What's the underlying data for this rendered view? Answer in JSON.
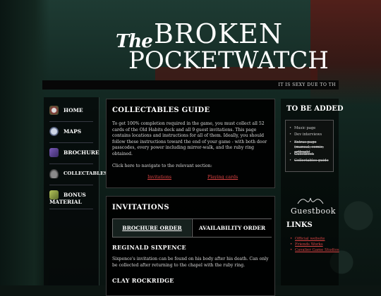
{
  "logo": {
    "the": "The",
    "broken": "BROKEN",
    "pocketwatch": "POCKETWATCH"
  },
  "ticker": "IT IS SEXY DUE TO TH",
  "nav": {
    "items": [
      {
        "label": "Home",
        "icon": "clock-icon"
      },
      {
        "label": "Maps",
        "icon": "mask-icon"
      },
      {
        "label": "Brochure",
        "icon": "crown-icon"
      },
      {
        "label": "Collectables",
        "icon": "hat-icon"
      },
      {
        "label": "Bonus",
        "label2": "Material",
        "icon": "bonus-icon"
      }
    ]
  },
  "guide": {
    "title": "Collectables Guide",
    "body": "To get 100% completion required in the game, you must collect all 52 cards of the Old Habits deck and all 9 guest invitations. This page contains locations and instructions for all of them. Ideally, you should follow these instructions toward the end of your game - with both door passcodes, every power including mirror-walk, and the ruby ring obtained.",
    "nav_prompt": "Click here to navigate to the relevant section:",
    "link_invitations": "Invitations",
    "link_cards": "Playing cards"
  },
  "invitations": {
    "title": "Invitations",
    "tab_brochure": "Brochure order",
    "tab_availability": "Availability order",
    "entry1_name": "Reginald Sixpence",
    "entry1_text": "Sixpence's invitation can be found on his body after his death. Can only be collected after returning to the chapel with the ruby ring.",
    "entry2_name": "Clay Rockridge"
  },
  "sidebar": {
    "to_be_added_title": "To be added",
    "todo": [
      {
        "text": "Music page",
        "struck": false
      },
      {
        "text": "Dev interviews",
        "struck": false
      },
      {
        "text": "Extras page (manual, comic, artbook)",
        "struck": true
      },
      {
        "text": "Guestbook",
        "struck": true
      },
      {
        "text": "Collectables guide",
        "struck": true
      }
    ],
    "guestbook": "Guestbook",
    "links_title": "Links",
    "links": [
      "Official website",
      "Friends Works",
      "Cavalier Game Studios"
    ]
  },
  "colors": {
    "accent_red": "#dd4444",
    "panel_bg": "#000000"
  }
}
